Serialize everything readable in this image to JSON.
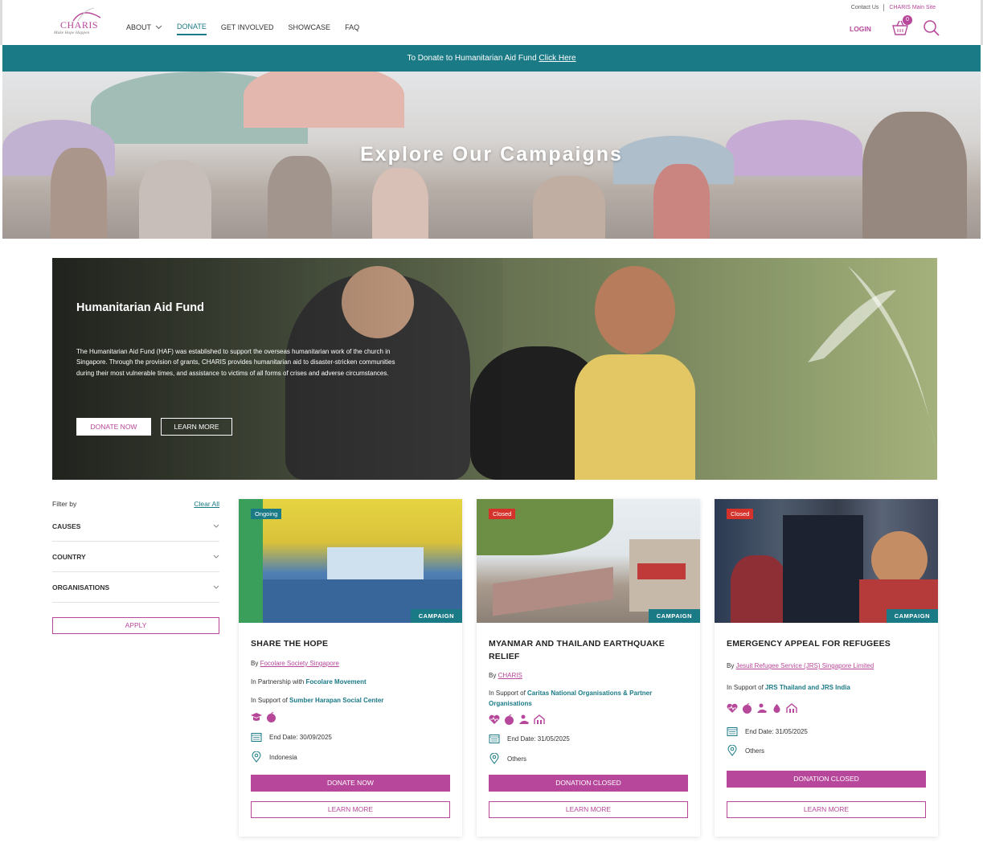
{
  "utility": {
    "contact": "Contact Us",
    "main_site": "CHARIS Main Site"
  },
  "brand": {
    "name": "CHARIS",
    "tagline": "Make Hope Happen",
    "accent": "#b7479a",
    "teal": "#1a7a86"
  },
  "nav": {
    "about": "ABOUT",
    "donate": "DONATE",
    "get_involved": "GET INVOLVED",
    "showcase": "SHOWCASE",
    "faq": "FAQ",
    "login": "LOGIN",
    "cart_count": "0"
  },
  "strip": {
    "text": "To Donate to Humanitarian Aid Fund ",
    "link": "Click Here"
  },
  "hero": {
    "title": "Explore Our Campaigns"
  },
  "feature": {
    "title": "Humanitarian Aid Fund",
    "body": "The Humanitarian Aid Fund (HAF) was established to support the overseas humanitarian work of the church in Singapore. Through the provision of grants, CHARIS provides humanitarian aid to disaster-stricken communities during their most vulnerable times, and assistance to victims of all forms of crises and adverse circumstances.",
    "donate": "DONATE NOW",
    "learn": "LEARN MORE"
  },
  "filters": {
    "label": "Filter by",
    "clear": "Clear All",
    "items": [
      "CAUSES",
      "COUNTRY",
      "ORGANISATIONS"
    ],
    "apply": "APPLY"
  },
  "cards": [
    {
      "status": "Ongoing",
      "tag": "CAMPAIGN",
      "title": "SHARE THE HOPE",
      "by_label": "By ",
      "by": "Focolare Society Singapore",
      "partner_label": "In Partnership with ",
      "partner": "Focolare Movement",
      "support_label": "In Support of ",
      "support": "Sumber Harapan Social Center",
      "end": "End Date: 30/09/2025",
      "location": "Indonesia",
      "primary": "DONATE NOW",
      "secondary": "LEARN MORE"
    },
    {
      "status": "Closed",
      "tag": "CAMPAIGN",
      "title": "MYANMAR AND THAILAND EARTHQUAKE RELIEF",
      "by_label": "By ",
      "by": "CHARIS",
      "support_label": "In Support of ",
      "support": "Caritas National Organisations & Partner Organisations",
      "end": "End Date: 31/05/2025",
      "location": "Others",
      "primary": "DONATION CLOSED",
      "secondary": "LEARN MORE"
    },
    {
      "status": "Closed",
      "tag": "CAMPAIGN",
      "title": "EMERGENCY APPEAL FOR REFUGEES",
      "by_label": "By ",
      "by": "Jesuit Refugee Service (JRS) Singapore Limited",
      "support_label": "In Support of ",
      "support": "JRS Thailand and JRS India",
      "end": "End Date: 31/05/2025",
      "location": "Others",
      "primary": "DONATION CLOSED",
      "secondary": "LEARN MORE"
    }
  ]
}
